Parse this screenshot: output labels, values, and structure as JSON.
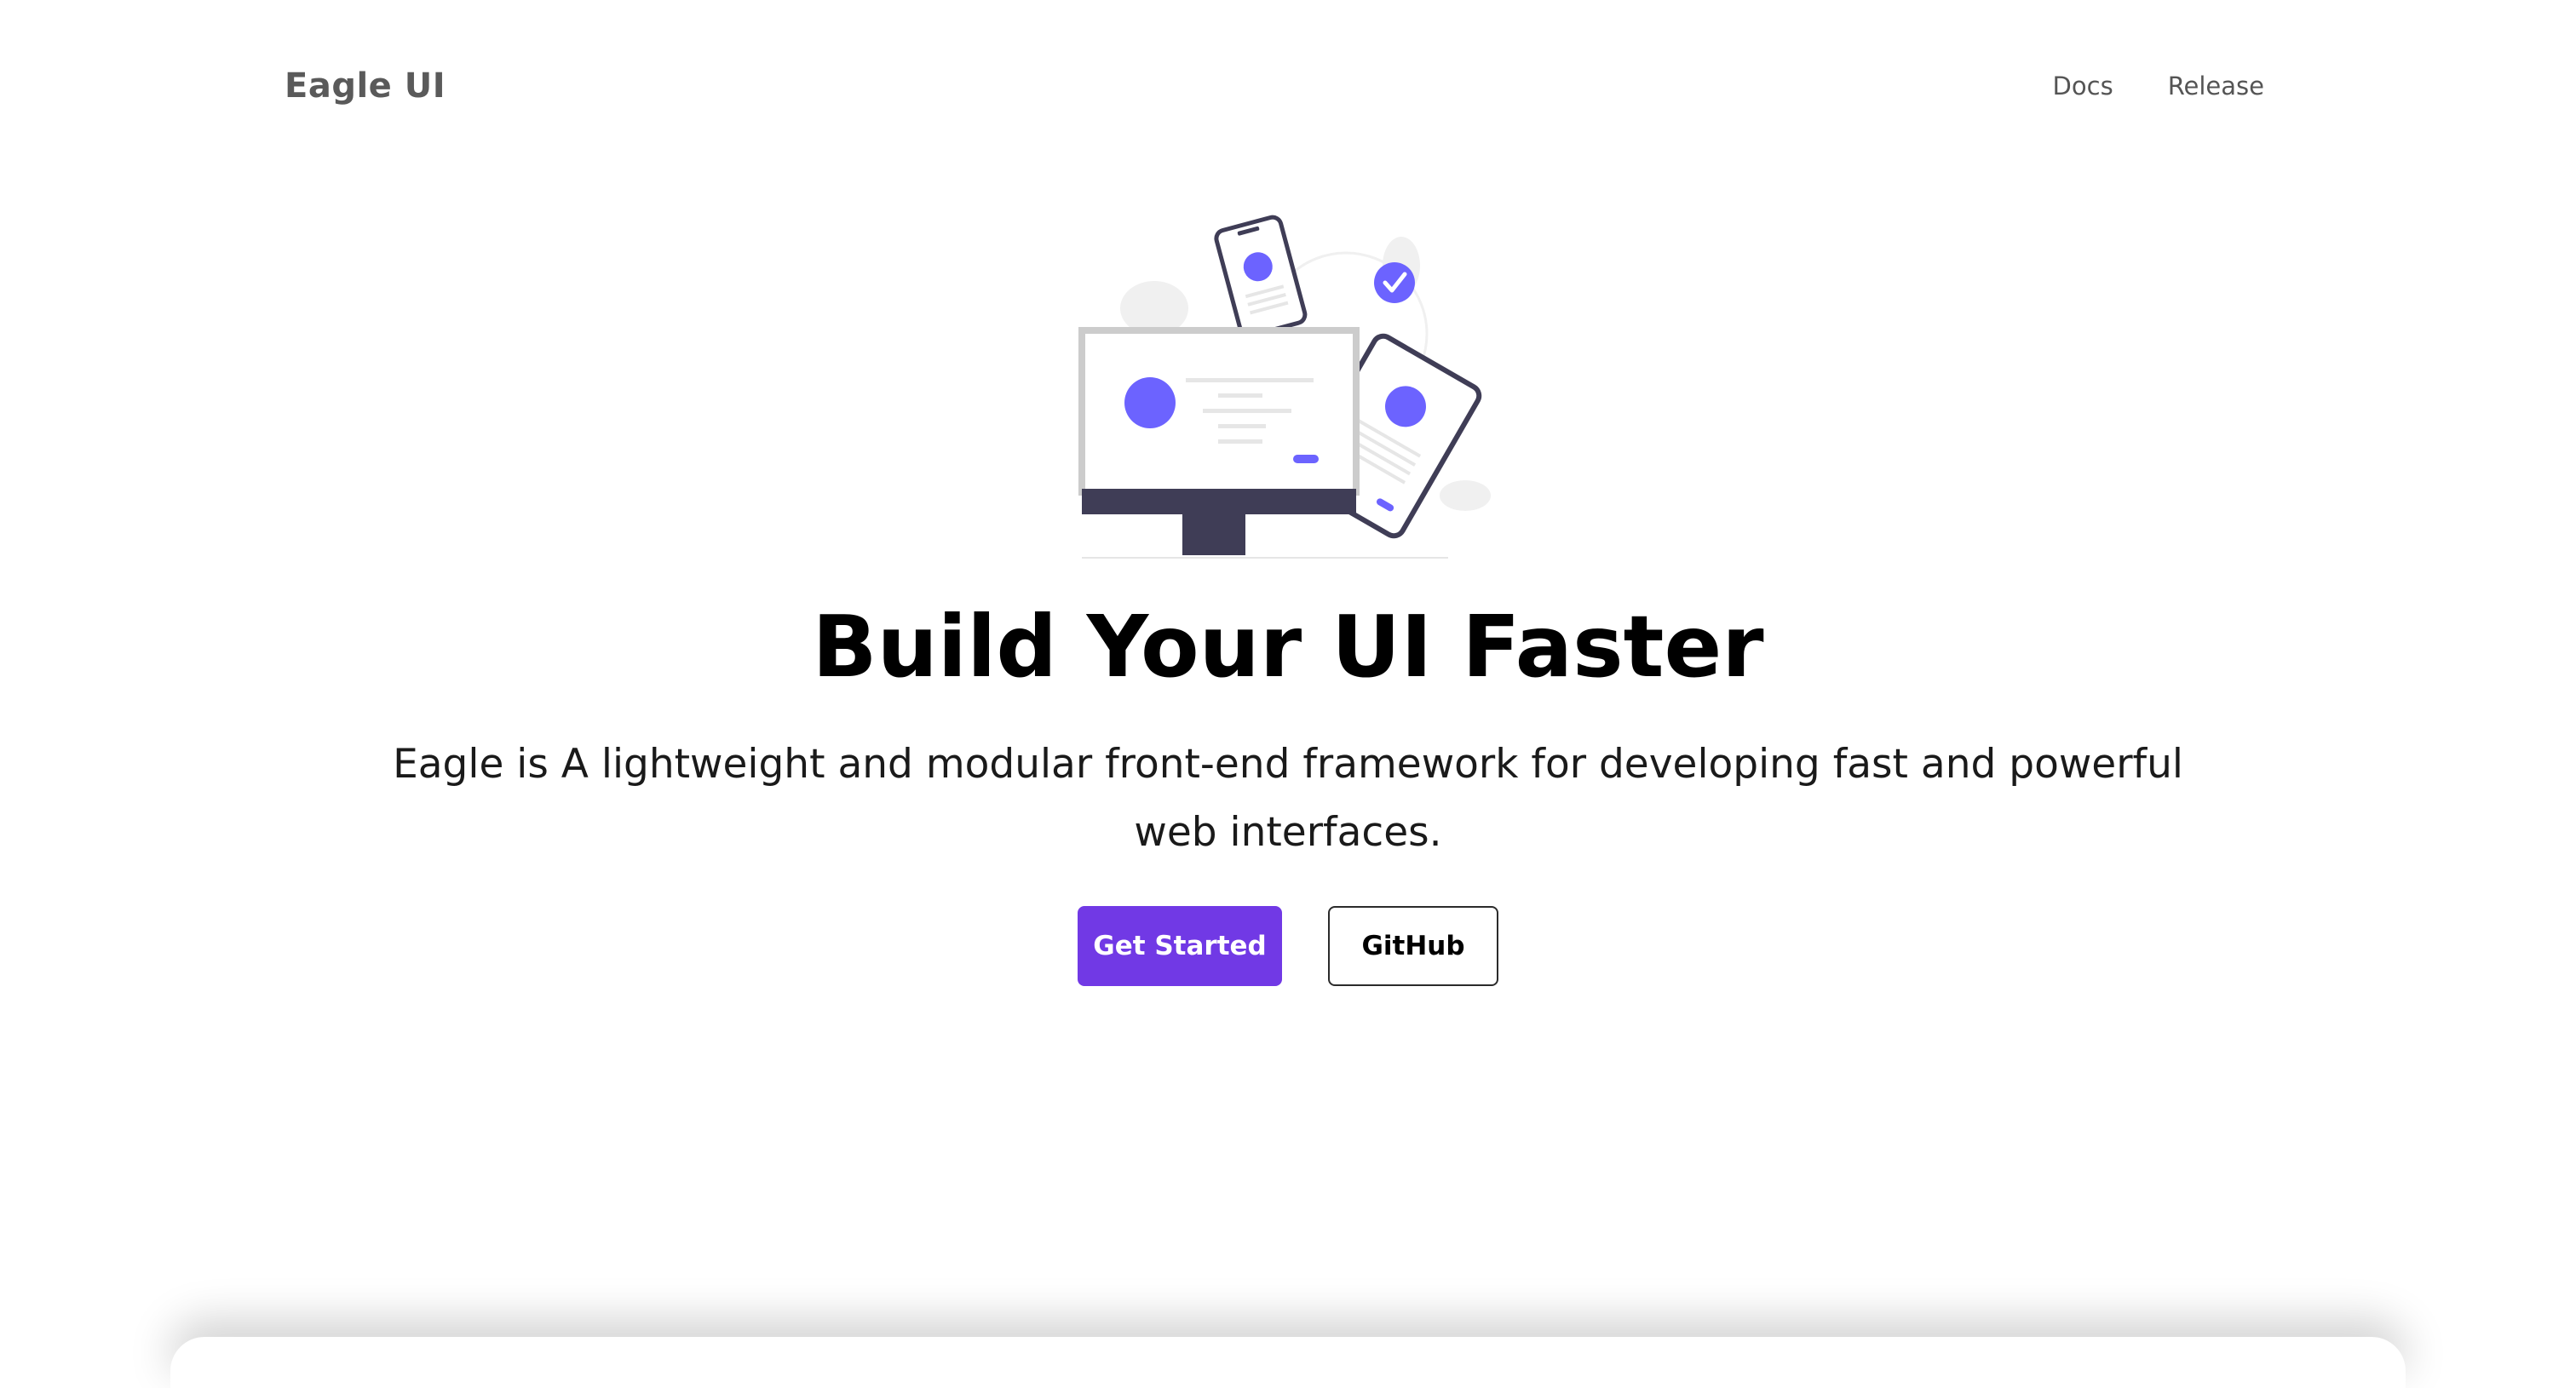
{
  "brand": "Eagle UI",
  "nav": {
    "items": [
      {
        "label": "Docs"
      },
      {
        "label": "Release"
      }
    ]
  },
  "hero": {
    "title": "Build Your UI Faster",
    "subtitle": "Eagle is A lightweight and modular front-end framework for developing fast and powerful web interfaces.",
    "primary_button": "Get Started",
    "secondary_button": "GitHub"
  },
  "colors": {
    "accent": "#7139e5",
    "illustration_accent": "#6c63ff",
    "illustration_dark": "#3f3d56"
  },
  "icons": {
    "illustration": "devices-illustration",
    "check": "check-circle-icon"
  }
}
